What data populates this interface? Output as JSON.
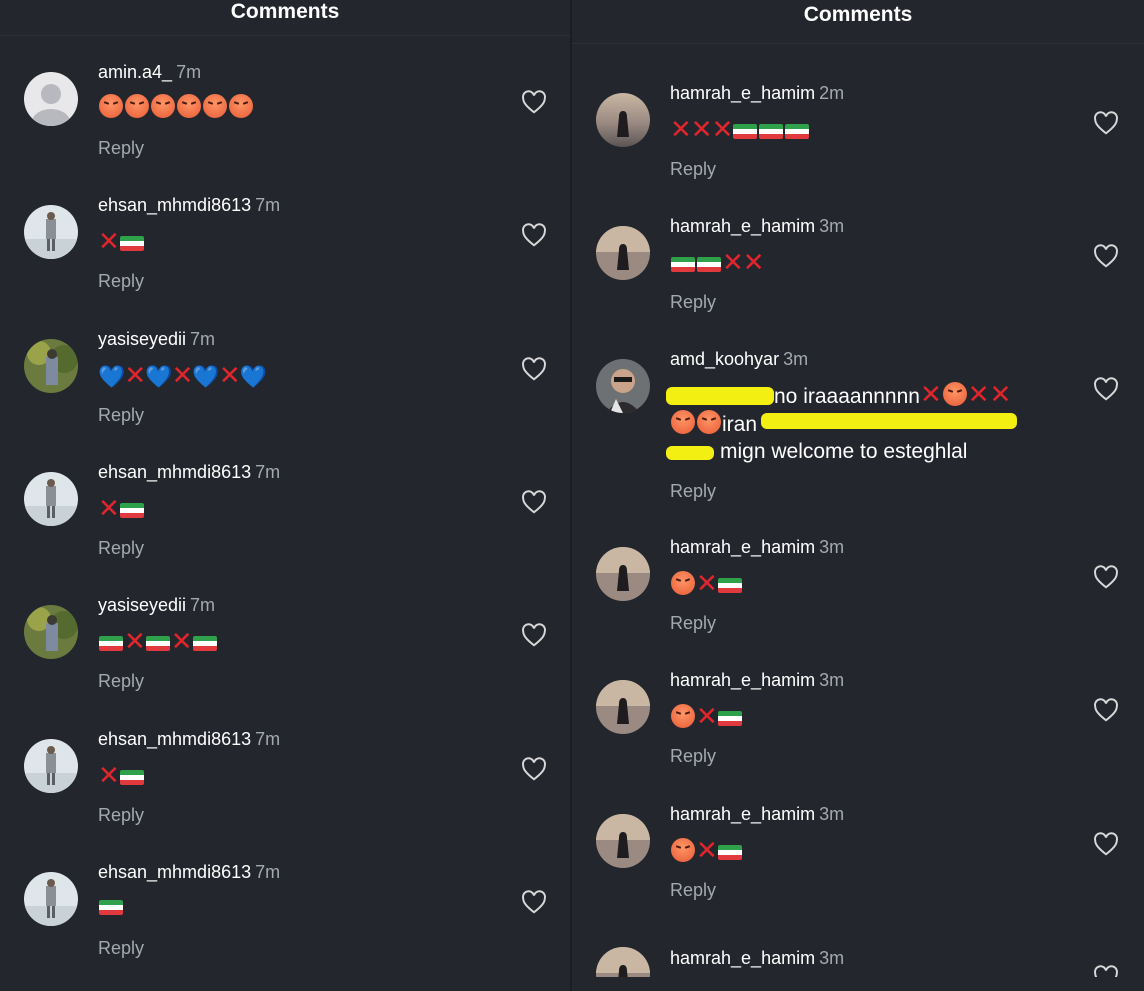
{
  "left": {
    "header_title": "Comments",
    "comments": [
      {
        "username": "amin.a4_",
        "time": "7m",
        "text": "😡😡😡😡😡😡",
        "reply": "Reply"
      },
      {
        "username": "ehsan_mhmdi8613",
        "time": "7m",
        "text": "❌🇮🇷",
        "reply": "Reply"
      },
      {
        "username": "yasiseyedii",
        "time": "7m",
        "text": "💙❌💙❌💙❌💙",
        "reply": "Reply"
      },
      {
        "username": "ehsan_mhmdi8613",
        "time": "7m",
        "text": "❌🇮🇷",
        "reply": "Reply"
      },
      {
        "username": "yasiseyedii",
        "time": "7m",
        "text": "🇮🇷❌🇮🇷❌🇮🇷",
        "reply": "Reply"
      },
      {
        "username": "ehsan_mhmdi8613",
        "time": "7m",
        "text": "❌🇮🇷",
        "reply": "Reply"
      },
      {
        "username": "ehsan_mhmdi8613",
        "time": "7m",
        "text": "🇮🇷",
        "reply": "Reply"
      }
    ]
  },
  "right": {
    "header_title": "Comments",
    "comments": [
      {
        "username": "hamrah_e_hamim",
        "time": "2m",
        "text": "❌❌❌🇮🇷🇮🇷🇮🇷",
        "reply": "Reply"
      },
      {
        "username": "hamrah_e_hamim",
        "time": "3m",
        "text": "🇮🇷🇮🇷❌❌",
        "reply": "Reply"
      },
      {
        "username": "amd_koohyar",
        "time": "3m",
        "text_line1": "no iraaaannnnn",
        "text_line2": "iran",
        "text_line3": "mign welcome to esteghlal",
        "reply": "Reply"
      },
      {
        "username": "hamrah_e_hamim",
        "time": "3m",
        "text": "😡❌🇮🇷",
        "reply": "Reply"
      },
      {
        "username": "hamrah_e_hamim",
        "time": "3m",
        "text": "😡❌🇮🇷",
        "reply": "Reply"
      },
      {
        "username": "hamrah_e_hamim",
        "time": "3m",
        "text": "😡❌🇮🇷",
        "reply": "Reply"
      },
      {
        "username": "hamrah_e_hamim",
        "time": "3m",
        "text": "",
        "reply": ""
      }
    ]
  },
  "icons": {
    "heart": "heart-outline-icon",
    "avatar": "user-avatar"
  },
  "colors": {
    "background": "#23262d",
    "text": "#ffffff",
    "muted": "#a4a8b0",
    "highlight": "#f3ef12"
  }
}
